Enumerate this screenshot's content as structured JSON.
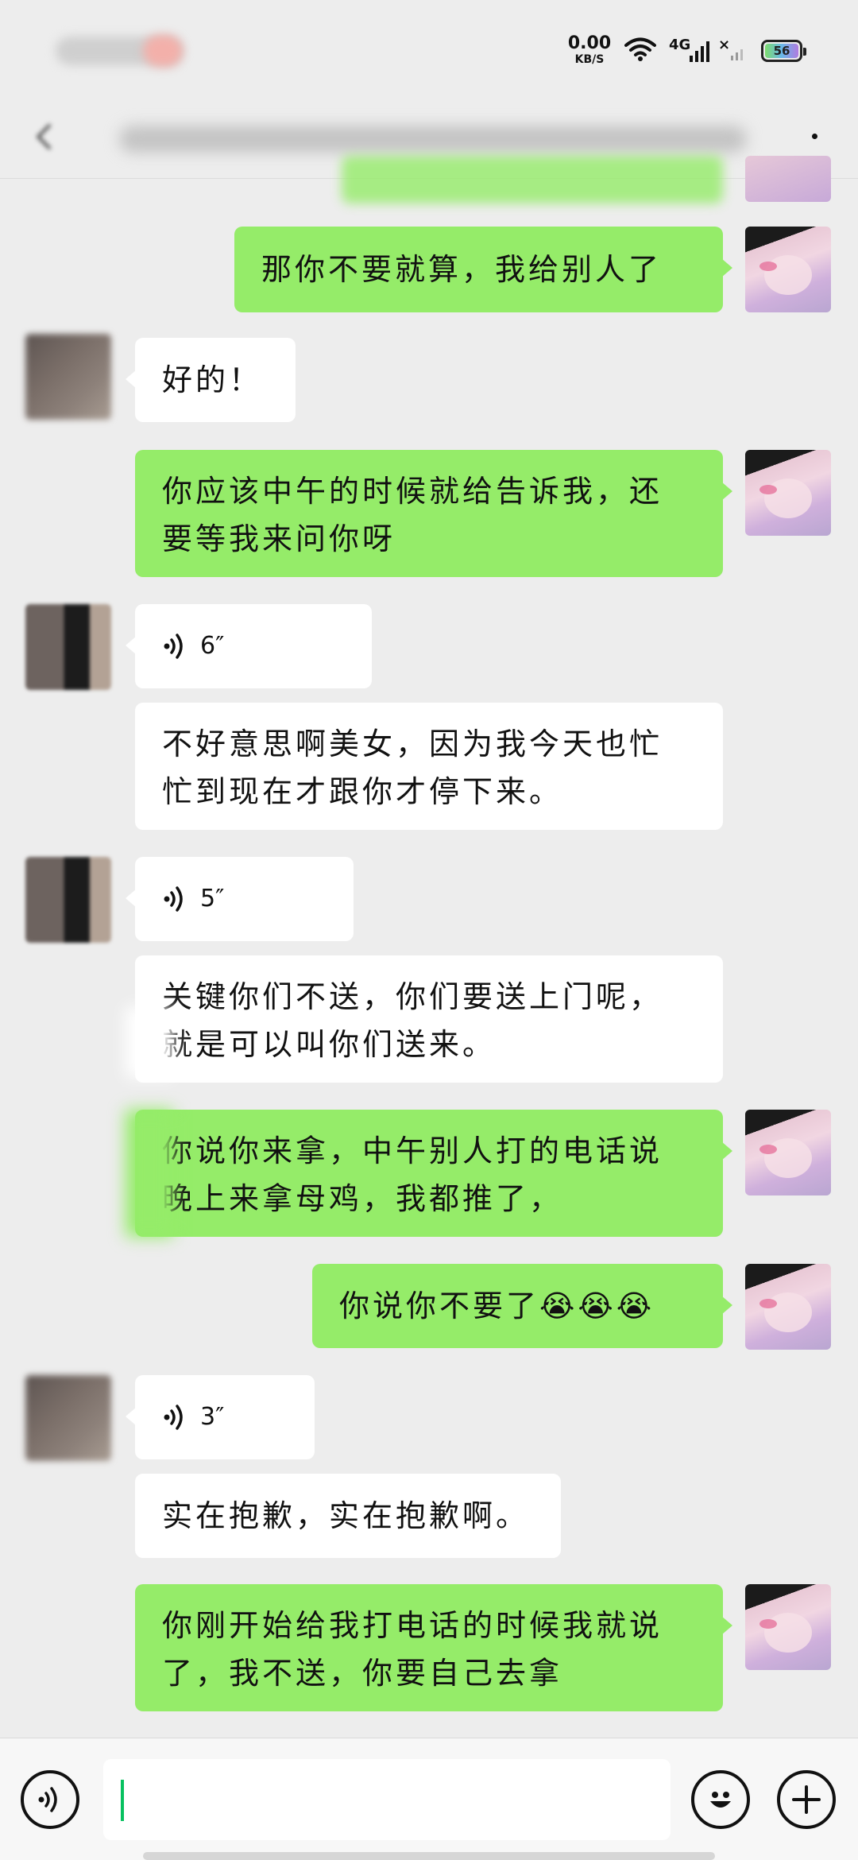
{
  "status_bar": {
    "net_speed_value": "0.00",
    "net_speed_unit": "KB/S",
    "network_type": "4G",
    "battery_level": "56",
    "icons": [
      "wifi-icon",
      "signal-icon",
      "battery-icon"
    ]
  },
  "header": {
    "icons": [
      "back-icon",
      "more-icon"
    ]
  },
  "messages": [
    {
      "sender": "self",
      "type": "text",
      "text": "那你不要就算，我给别人了"
    },
    {
      "sender": "other",
      "type": "text",
      "text": "好的！"
    },
    {
      "sender": "self",
      "type": "text",
      "text": "你应该中午的时候就给告诉我，还\n要等我来问你呀"
    },
    {
      "sender": "other",
      "type": "voice",
      "duration": "6″"
    },
    {
      "sender": "other",
      "type": "text",
      "text": "不好意思啊美女，因为我今天也忙\n忙到现在才跟你才停下来。"
    },
    {
      "sender": "other",
      "type": "voice",
      "duration": "5″"
    },
    {
      "sender": "other",
      "type": "text",
      "text": "关键你们不送，你们要送上门呢，\n就是可以叫你们送来。"
    },
    {
      "sender": "self",
      "type": "text",
      "text": "你说你来拿，中午别人打的电话说\n晚上来拿母鸡，我都推了，"
    },
    {
      "sender": "self",
      "type": "text",
      "text": "你说你不要了😭😭😭"
    },
    {
      "sender": "other",
      "type": "voice",
      "duration": "3″"
    },
    {
      "sender": "other",
      "type": "text",
      "text": "实在抱歉，实在抱歉啊。"
    },
    {
      "sender": "self",
      "type": "text",
      "text": "你刚开始给我打电话的时候我就说\n了，我不送，你要自己去拿"
    }
  ],
  "input_bar": {
    "placeholder": "",
    "icons": [
      "voice-toggle-icon",
      "emoji-icon",
      "plus-icon"
    ]
  },
  "colors": {
    "background": "#ededed",
    "self_bubble": "#95ec69",
    "other_bubble": "#ffffff",
    "caret": "#07c160"
  }
}
